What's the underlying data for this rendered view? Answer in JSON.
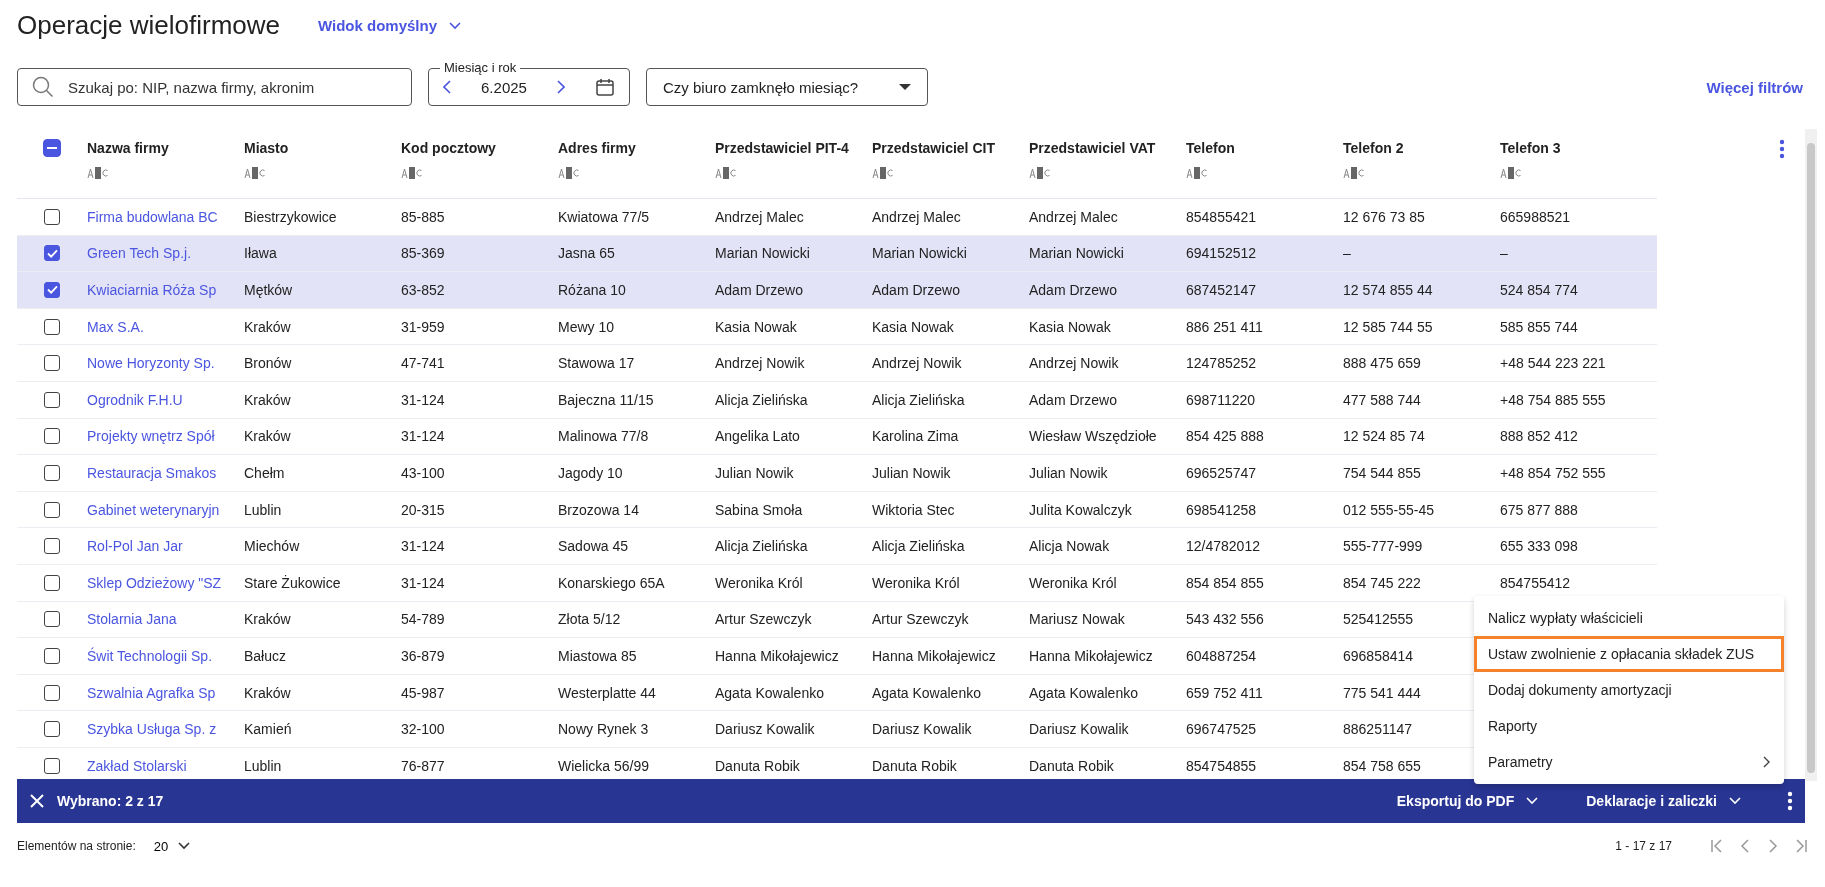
{
  "page": {
    "title": "Operacje wielofirmowe",
    "view_selector": "Widok domyślny"
  },
  "filters": {
    "search": {
      "placeholder": "Szukaj po: NIP, nazwa firmy, akronim"
    },
    "month": {
      "label": "Miesiąc i rok",
      "value": "6.2025"
    },
    "office_closed": {
      "placeholder": "Czy biuro zamknęło miesiąc?"
    },
    "more_filters": "Więcej filtrów"
  },
  "table": {
    "header_checkbox": {
      "indeterminate": true
    },
    "columns": [
      "Nazwa firmy",
      "Miasto",
      "Kod pocztowy",
      "Adres firmy",
      "Przedstawiciel PIT-4",
      "Przedstawiciel CIT",
      "Przedstawiciel VAT",
      "Telefon",
      "Telefon 2",
      "Telefon 3"
    ],
    "rows": [
      {
        "selected": false,
        "cells": [
          "Firma budowlana BC",
          "Biestrzykowice",
          "85-885",
          "Kwiatowa 77/5",
          "Andrzej Malec",
          "Andrzej Malec",
          "Andrzej Malec",
          "854855421",
          "12 676 73 85",
          "665988521"
        ]
      },
      {
        "selected": true,
        "cells": [
          "Green Tech Sp.j.",
          "Iława",
          "85-369",
          "Jasna 65",
          "Marian Nowicki",
          "Marian Nowicki",
          "Marian Nowicki",
          "694152512",
          "–",
          "–"
        ]
      },
      {
        "selected": true,
        "cells": [
          "Kwiaciarnia Róża Sp",
          "Mętków",
          "63-852",
          "Różana 10",
          "Adam Drzewo",
          "Adam Drzewo",
          "Adam Drzewo",
          "687452147",
          "12 574 855 44",
          "524 854 774"
        ]
      },
      {
        "selected": false,
        "cells": [
          "Max S.A.",
          "Kraków",
          "31-959",
          "Mewy 10",
          "Kasia Nowak",
          "Kasia Nowak",
          "Kasia Nowak",
          "886 251 411",
          "12 585 744 55",
          "585 855 744"
        ]
      },
      {
        "selected": false,
        "cells": [
          "Nowe Horyzonty Sp.",
          "Bronów",
          "47-741",
          "Stawowa 17",
          "Andrzej Nowik",
          "Andrzej Nowik",
          "Andrzej Nowik",
          "124785252",
          "888 475 659",
          "+48 544 223 221"
        ]
      },
      {
        "selected": false,
        "cells": [
          "Ogrodnik F.H.U",
          "Kraków",
          "31-124",
          "Bajeczna 11/15",
          "Alicja Zielińska",
          "Alicja Zielińska",
          "Adam Drzewo",
          "698711220",
          "477 588 744",
          "+48 754 885 555"
        ]
      },
      {
        "selected": false,
        "cells": [
          "Projekty wnętrz Spół",
          "Kraków",
          "31-124",
          "Malinowa 77/8",
          "Angelika Lato",
          "Karolina Zima",
          "Wiesław Wszędziołe",
          "854 425 888",
          "12 524 85 74",
          "888 852 412"
        ]
      },
      {
        "selected": false,
        "cells": [
          "Restauracja Smakos",
          "Chełm",
          "43-100",
          "Jagody 10",
          "Julian Nowik",
          "Julian Nowik",
          "Julian Nowik",
          "696525747",
          "754 544 855",
          "+48 854 752 555"
        ]
      },
      {
        "selected": false,
        "cells": [
          "Gabinet weterynaryjn",
          "Lublin",
          "20-315",
          "Brzozowa 14",
          "Sabina Smoła",
          "Wiktoria Stec",
          "Julita Kowalczyk",
          "698541258",
          "012 555-55-45",
          "675 877 888"
        ]
      },
      {
        "selected": false,
        "cells": [
          "Rol-Pol Jan Jar",
          "Miechów",
          "31-124",
          "Sadowa 45",
          "Alicja Zielińska",
          "Alicja Zielińska",
          "Alicja Nowak",
          "12/4782012",
          "555-777-999",
          "655 333 098"
        ]
      },
      {
        "selected": false,
        "cells": [
          "Sklep Odzieżowy \"SZ",
          "Stare Żukowice",
          "31-124",
          "Konarskiego 65A",
          "Weronika Król",
          "Weronika Król",
          "Weronika Król",
          "854 854 855",
          "854 745 222",
          "854755412"
        ]
      },
      {
        "selected": false,
        "cells": [
          "Stolarnia Jana",
          "Kraków",
          "54-789",
          "Złota 5/12",
          "Artur Szewczyk",
          "Artur Szewczyk",
          "Mariusz Nowak",
          "543 432 556",
          "525412555"
        ]
      },
      {
        "selected": false,
        "cells": [
          "Świt Technologii Sp.",
          "Bałucz",
          "36-879",
          "Miastowa 85",
          "Hanna Mikołajewicz",
          "Hanna Mikołajewicz",
          "Hanna Mikołajewicz",
          "604887254",
          "696858414"
        ]
      },
      {
        "selected": false,
        "cells": [
          "Szwalnia Agrafka Sp",
          "Kraków",
          "45-987",
          "Westerplatte 44",
          "Agata Kowalenko",
          "Agata Kowalenko",
          "Agata Kowalenko",
          "659 752 411",
          "775 541 444"
        ]
      },
      {
        "selected": false,
        "cells": [
          "Szybka Usługa Sp. z",
          "Kamień",
          "32-100",
          "Nowy Rynek 3",
          "Dariusz Kowalik",
          "Dariusz Kowalik",
          "Dariusz Kowalik",
          "696747525",
          "886251147"
        ]
      },
      {
        "selected": false,
        "cells": [
          "Zakład Stolarski",
          "Lublin",
          "76-877",
          "Wielicka 56/99",
          "Danuta Robik",
          "Danuta Robik",
          "Danuta Robik",
          "854754855",
          "854 758 655"
        ]
      }
    ]
  },
  "context_menu": [
    {
      "label": "Nalicz wypłaty właścicieli",
      "highlighted": false,
      "submenu": false
    },
    {
      "label": "Ustaw zwolnienie z opłacania składek ZUS",
      "highlighted": true,
      "submenu": false
    },
    {
      "label": "Dodaj dokumenty amortyzacji",
      "highlighted": false,
      "submenu": false
    },
    {
      "label": "Raporty",
      "highlighted": false,
      "submenu": false
    },
    {
      "label": "Parametry",
      "highlighted": false,
      "submenu": true
    }
  ],
  "selection_bar": {
    "count": "Wybrano: 2 z 17",
    "actions": [
      "Eksportuj do PDF",
      "Deklaracje i zaliczki"
    ]
  },
  "footer": {
    "page_size_label": "Elementów na stronie:",
    "page_size": "20",
    "range": "1 - 17 z 17"
  }
}
